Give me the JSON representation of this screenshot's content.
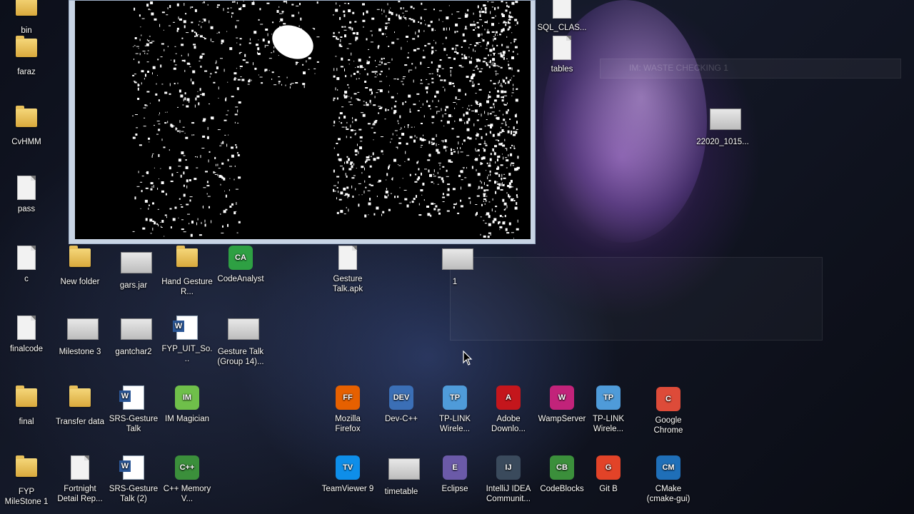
{
  "desktop": {
    "ghost_window_title": "IM: WASTE CHECKING 1",
    "icons": [
      {
        "id": "bin",
        "label": "bin",
        "type": "folder"
      },
      {
        "id": "faraz",
        "label": "faraz",
        "type": "folder"
      },
      {
        "id": "cvhmm",
        "label": "CvHMM",
        "type": "folder"
      },
      {
        "id": "pass",
        "label": "pass",
        "type": "doc"
      },
      {
        "id": "c",
        "label": "c",
        "type": "doc"
      },
      {
        "id": "finalcode",
        "label": "finalcode",
        "type": "doc"
      },
      {
        "id": "final",
        "label": "final",
        "type": "folder"
      },
      {
        "id": "fyp-milestone",
        "label": "FYP MileStone 1",
        "type": "folder"
      },
      {
        "id": "new-folder",
        "label": "New folder",
        "type": "folder"
      },
      {
        "id": "milestone3",
        "label": "Milestone 3",
        "type": "img"
      },
      {
        "id": "transfer-data",
        "label": "Transfer data",
        "type": "folder"
      },
      {
        "id": "fortnight",
        "label": "Fortnight Detail Rep...",
        "type": "doc"
      },
      {
        "id": "gars-jar",
        "label": "gars.jar",
        "type": "img"
      },
      {
        "id": "gantchar2",
        "label": "gantchar2",
        "type": "img"
      },
      {
        "id": "srs-gesture-talk",
        "label": "SRS-Gesture Talk",
        "type": "word"
      },
      {
        "id": "srs-gesture-talk-2",
        "label": "SRS-Gesture Talk (2)",
        "type": "word"
      },
      {
        "id": "hand-gesture",
        "label": "Hand Gesture R...",
        "type": "folder"
      },
      {
        "id": "fyp-uit",
        "label": "FYP_UIT_So...",
        "type": "word"
      },
      {
        "id": "im-magician",
        "label": "IM Magician",
        "type": "app"
      },
      {
        "id": "cpp-memory",
        "label": "C++ Memory V...",
        "type": "app"
      },
      {
        "id": "codeanalyst",
        "label": "CodeAnalyst",
        "type": "app"
      },
      {
        "id": "gesture-talk-group",
        "label": "Gesture Talk (Group 14)...",
        "type": "img"
      },
      {
        "id": "gesture-talk-apk",
        "label": "Gesture Talk.apk",
        "type": "doc"
      },
      {
        "id": "one",
        "label": "1",
        "type": "img"
      },
      {
        "id": "mozilla-firefox",
        "label": "Mozilla Firefox",
        "type": "app"
      },
      {
        "id": "teamviewer",
        "label": "TeamViewer 9",
        "type": "app"
      },
      {
        "id": "dev-cpp",
        "label": "Dev-C++",
        "type": "app"
      },
      {
        "id": "timetable",
        "label": "timetable",
        "type": "img"
      },
      {
        "id": "tp-link",
        "label": "TP-LINK Wirele...",
        "type": "app"
      },
      {
        "id": "eclipse",
        "label": "Eclipse",
        "type": "app"
      },
      {
        "id": "adobe",
        "label": "Adobe Downlo...",
        "type": "app"
      },
      {
        "id": "intellij",
        "label": "IntelliJ IDEA Communit...",
        "type": "app"
      },
      {
        "id": "wampserver",
        "label": "WampServer",
        "type": "app"
      },
      {
        "id": "codeblocks",
        "label": "CodeBlocks",
        "type": "app"
      },
      {
        "id": "tp-link-2",
        "label": "TP-LINK Wirele...",
        "type": "app"
      },
      {
        "id": "git-bash",
        "label": "Git B",
        "type": "app"
      },
      {
        "id": "google-chrome",
        "label": "Google Chrome",
        "type": "app"
      },
      {
        "id": "cmake",
        "label": "CMake (cmake-gui)",
        "type": "app"
      },
      {
        "id": "tables",
        "label": "tables",
        "type": "doc"
      },
      {
        "id": "sql-class",
        "label": "SQL_CLAS...",
        "type": "doc"
      },
      {
        "id": "photo-22020",
        "label": "22020_1015...",
        "type": "img"
      }
    ]
  },
  "colors": {
    "firefox": "#e66000",
    "devcpp": "#3b6fb6",
    "tplink": "#4f9bd9",
    "adobe": "#c4161c",
    "wamp": "#c2237a",
    "chrome": "#dd4b39",
    "teamviewer": "#0e8ee9",
    "eclipse": "#6b5aa8",
    "intellij": "#3a4a5c",
    "codeblocks": "#3b8f3b",
    "git": "#e24328",
    "cmake": "#1f6fb8",
    "codeanalyst": "#2ea043",
    "immagician": "#6fbf4a"
  }
}
